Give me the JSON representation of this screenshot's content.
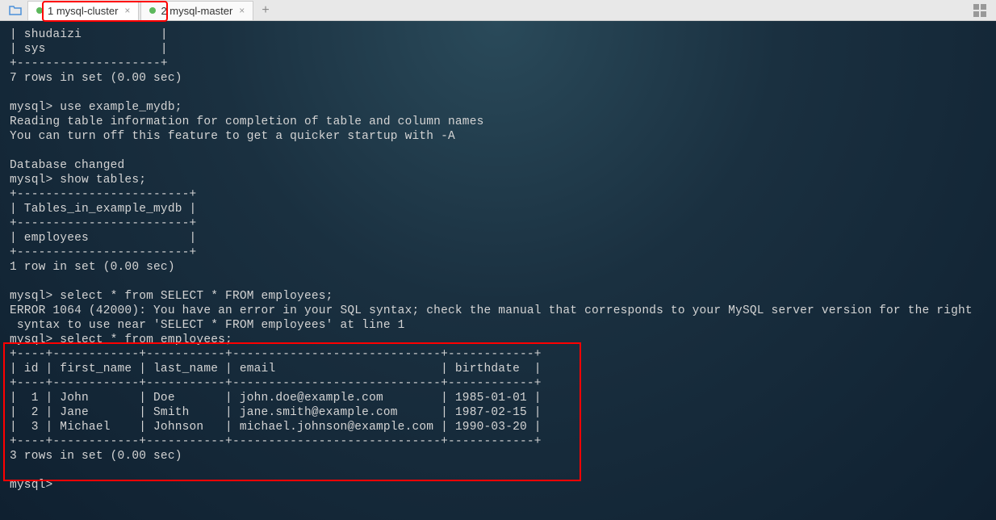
{
  "tabs": [
    {
      "label": "1 mysql-cluster",
      "active": true
    },
    {
      "label": "2 mysql-master",
      "active": false
    }
  ],
  "terminal": {
    "lines": [
      "| shudaizi           |",
      "| sys                |",
      "+--------------------+",
      "7 rows in set (0.00 sec)",
      "",
      "mysql> use example_mydb;",
      "Reading table information for completion of table and column names",
      "You can turn off this feature to get a quicker startup with -A",
      "",
      "Database changed",
      "mysql> show tables;",
      "+------------------------+",
      "| Tables_in_example_mydb |",
      "+------------------------+",
      "| employees              |",
      "+------------------------+",
      "1 row in set (0.00 sec)",
      "",
      "mysql> select * from SELECT * FROM employees;",
      "ERROR 1064 (42000): You have an error in your SQL syntax; check the manual that corresponds to your MySQL server version for the right",
      " syntax to use near 'SELECT * FROM employees' at line 1",
      "mysql> select * from employees;",
      "+----+------------+-----------+-----------------------------+------------+",
      "| id | first_name | last_name | email                       | birthdate  |",
      "+----+------------+-----------+-----------------------------+------------+",
      "|  1 | John       | Doe       | john.doe@example.com        | 1985-01-01 |",
      "|  2 | Jane       | Smith     | jane.smith@example.com      | 1987-02-15 |",
      "|  3 | Michael    | Johnson   | michael.johnson@example.com | 1990-03-20 |",
      "+----+------------+-----------+-----------------------------+------------+",
      "3 rows in set (0.00 sec)",
      "",
      "mysql> "
    ]
  }
}
